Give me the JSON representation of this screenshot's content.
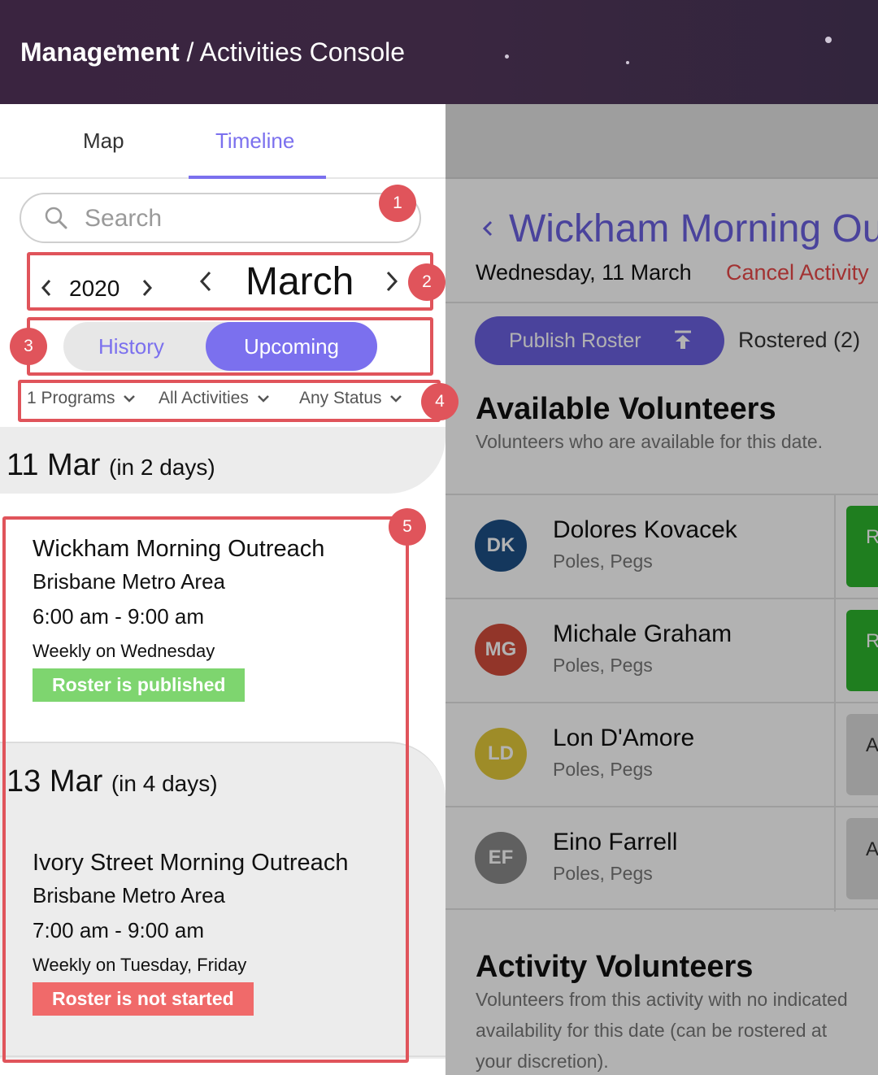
{
  "header": {
    "breadcrumb_root": "Management",
    "breadcrumb_sep": " / ",
    "breadcrumb_page": "Activities Console"
  },
  "left_panel": {
    "tabs": [
      {
        "label": "Map",
        "active": false
      },
      {
        "label": "Timeline",
        "active": true
      }
    ],
    "search": {
      "placeholder": "Search"
    },
    "year": "2020",
    "month": "March",
    "segments": [
      {
        "label": "History",
        "active": false
      },
      {
        "label": "Upcoming",
        "active": true
      }
    ],
    "filters": [
      {
        "label": "1 Programs"
      },
      {
        "label": "All Activities"
      },
      {
        "label": "Any Status"
      }
    ],
    "days": [
      {
        "date": "11 Mar",
        "relative": "(in 2 days)",
        "activities": [
          {
            "name": "Wickham Morning Outreach",
            "area": "Brisbane Metro Area",
            "time": "6:00 am - 9:00 am",
            "recurrence": "Weekly on Wednesday",
            "status": "Roster is published",
            "status_color": "#7ed56f"
          }
        ]
      },
      {
        "date": "13 Mar",
        "relative": "(in 4 days)",
        "activities": [
          {
            "name": "Ivory Street Morning Outreach",
            "area": "Brisbane Metro Area",
            "time": "7:00 am - 9:00 am",
            "recurrence": "Weekly on Tuesday, Friday",
            "status": "Roster is not started",
            "status_color": "#f06a6a"
          }
        ]
      }
    ]
  },
  "annotations": {
    "markers": [
      "1",
      "2",
      "3",
      "4",
      "5"
    ],
    "color": "#e0545b"
  },
  "detail_panel": {
    "back_icon": "chevron-left-icon",
    "title": "Wickham Morning Out",
    "date": "Wednesday, 11 March",
    "cancel_label": "Cancel Activity",
    "publish_label": "Publish Roster",
    "publish_icon": "upload-icon",
    "rostered_label": "Rostered (2)",
    "available": {
      "heading": "Available Volunteers",
      "subtitle": "Volunteers who are available for this date."
    },
    "volunteers": [
      {
        "initials": "DK",
        "name": "Dolores Kovacek",
        "skills": "Poles, Pegs",
        "avatar_color": "#1d4f86",
        "action_label": "R",
        "action_color": "#2db52d"
      },
      {
        "initials": "MG",
        "name": "Michale Graham",
        "skills": "Poles, Pegs",
        "avatar_color": "#d24c3c",
        "action_label": "R",
        "action_color": "#2db52d"
      },
      {
        "initials": "LD",
        "name": "Lon D'Amore",
        "skills": "Poles, Pegs",
        "avatar_color": "#e2c93a",
        "action_label": "A",
        "action_color": "#dcdcdc"
      },
      {
        "initials": "EF",
        "name": "Eino Farrell",
        "skills": "Poles, Pegs",
        "avatar_color": "#8a8a8a",
        "action_label": "A",
        "action_color": "#dcdcdc"
      }
    ],
    "activity_volunteers": {
      "heading": "Activity Volunteers",
      "subtitle": "Volunteers from this activity with no indicated availability for this date (can be rostered at your discretion)."
    },
    "primary_color": "#6b60e0",
    "danger_color": "#e84848"
  }
}
